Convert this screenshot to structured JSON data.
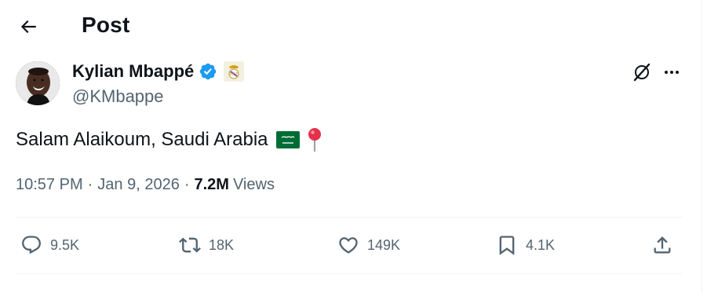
{
  "header": {
    "title": "Post"
  },
  "author": {
    "display_name": "Kylian Mbappé",
    "handle": "@KMbappe"
  },
  "post": {
    "text": "Salam Alaikoum, Saudi Arabia",
    "time": "10:57 PM",
    "date": "Jan 9, 2026",
    "views_count": "7.2M",
    "views_label": "Views"
  },
  "actions": {
    "replies": "9.5K",
    "reposts": "18K",
    "likes": "149K",
    "bookmarks": "4.1K"
  },
  "colors": {
    "text": "#0f1419",
    "secondary": "#536471",
    "verified": "#1d9bf0",
    "divider": "#eff3f4",
    "flag_green": "#006c35"
  },
  "icons": {
    "back": "arrow-left-icon",
    "verified": "verified-badge-icon",
    "club": "real-madrid-crest-icon",
    "grok": "grok-icon",
    "more": "more-dots-icon",
    "flag": "saudi-arabia-flag-icon",
    "pin": "round-pushpin-icon",
    "reply": "reply-icon",
    "repost": "repost-icon",
    "like": "heart-icon",
    "bookmark": "bookmark-icon",
    "share": "share-icon"
  }
}
